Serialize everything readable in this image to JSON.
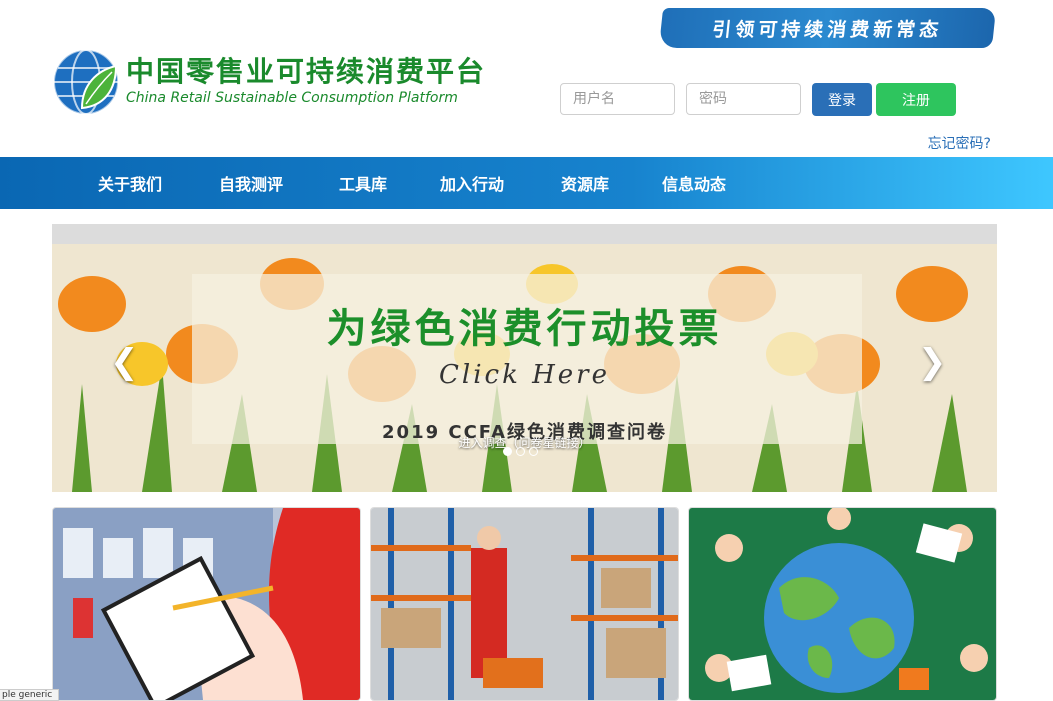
{
  "header": {
    "slogan": "引领可持续消费新常态",
    "logo_cn": "中国零售业可持续消费平台",
    "logo_en": "China Retail Sustainable Consumption Platform",
    "username_placeholder": "用户名",
    "password_placeholder": "密码",
    "login_label": "登录",
    "register_label": "注册",
    "forgot_label": "忘记密码?"
  },
  "nav": {
    "items": [
      "关于我们",
      "自我测评",
      "工具库",
      "加入行动",
      "资源库",
      "信息动态"
    ]
  },
  "carousel": {
    "title": "为绿色消费行动投票",
    "click": "Click Here",
    "subtitle": "2019 CCFA绿色消费调查问卷",
    "caption": "进入调查（问卷星链接）",
    "slide_count": 3,
    "active_slide": 1
  },
  "status_bar": {
    "text": "ple generic"
  },
  "colors": {
    "nav_blue": "#0a67b3",
    "login_blue": "#2a6fb7",
    "register_green": "#2ec55e",
    "logo_green": "#1a8a2c"
  }
}
